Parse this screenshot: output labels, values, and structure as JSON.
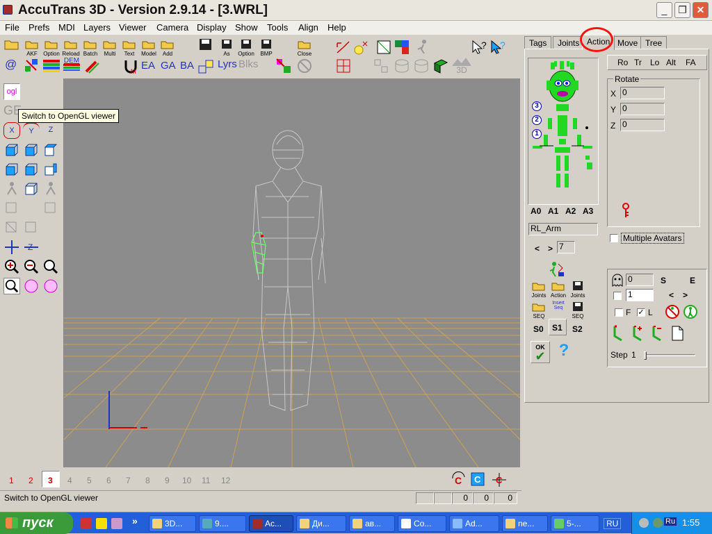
{
  "window": {
    "title": "AccuTrans 3D - Version 2.9.14 - [3.WRL]"
  },
  "menu": [
    "File",
    "Prefs",
    "MDI",
    "Layers",
    "Viewer",
    "Camera",
    "Display",
    "Show",
    "Tools",
    "Align",
    "Help"
  ],
  "toolbar1": [
    {
      "label": "AKF"
    },
    {
      "label": "Option"
    },
    {
      "label": "Reload"
    },
    {
      "label": "Batch"
    },
    {
      "label": "Multi"
    },
    {
      "label": "Text"
    },
    {
      "label": "Model"
    },
    {
      "label": "Add"
    }
  ],
  "toolbar1b": [
    {
      "label": ""
    },
    {
      "label": "As"
    },
    {
      "label": "Option"
    },
    {
      "label": "BMP"
    },
    {
      "label": "Close"
    }
  ],
  "toolbar2_text": {
    "ea": "EA",
    "ga": "GA",
    "ba": "BA",
    "lyrs": "Lyrs",
    "blks": "Blks",
    "dem": "DEM",
    "at": "@",
    "s3d": "3D"
  },
  "left_toolbar": {
    "ogl": "ogl",
    "x": "X",
    "y": "Y",
    "z": "Z"
  },
  "tooltip": "Switch to OpenGL viewer",
  "frames": {
    "numbers": [
      "1",
      "2",
      "3",
      "4",
      "5",
      "6",
      "7",
      "8",
      "9",
      "10",
      "11",
      "12"
    ],
    "active": "3"
  },
  "status": {
    "text": "Switch to OpenGL viewer",
    "v1": "0",
    "v2": "0",
    "v3": "0"
  },
  "tabs": [
    "Tags",
    "Joints",
    "Action",
    "Move",
    "Tree"
  ],
  "panel": {
    "rot_buttons": [
      "Ro",
      "Tr",
      "Lo",
      "Alt",
      "FA"
    ],
    "rotate_label": "Rotate",
    "axes": [
      {
        "name": "X",
        "value": "0"
      },
      {
        "name": "Y",
        "value": "0"
      },
      {
        "name": "Z",
        "value": "0"
      }
    ],
    "levels": [
      "3",
      "2",
      "1"
    ],
    "avatars": [
      "A0",
      "A1",
      "A2",
      "A3"
    ],
    "joint_name": "RL_Arm",
    "nav_prev": "<",
    "nav_next": ">",
    "nav_value": "7",
    "file_buttons": [
      "Joints",
      "Action",
      "Joints"
    ],
    "seq_buttons": [
      "SEQ",
      "Insert Seq",
      "SEQ"
    ],
    "s_buttons": [
      "S0",
      "S1",
      "S2"
    ],
    "ok": "OK",
    "help": "?",
    "multiple_avatars": "Multiple Avatars",
    "lower": {
      "v1": "0",
      "v2": "1",
      "s": "S",
      "e": "E",
      "f": "F",
      "l": "L",
      "l_checked": "✓",
      "prev": "<",
      "next": ">",
      "step_label": "Step",
      "step_value": "1"
    }
  },
  "taskbar": {
    "start": "пуск",
    "tasks": [
      "3D...",
      "9....",
      "Ac...",
      "Ди...",
      "ав...",
      "Co...",
      "Ad...",
      "ne...",
      "5-..."
    ],
    "lang": "RU",
    "tray_lang": "Ru",
    "time": "1:55"
  }
}
